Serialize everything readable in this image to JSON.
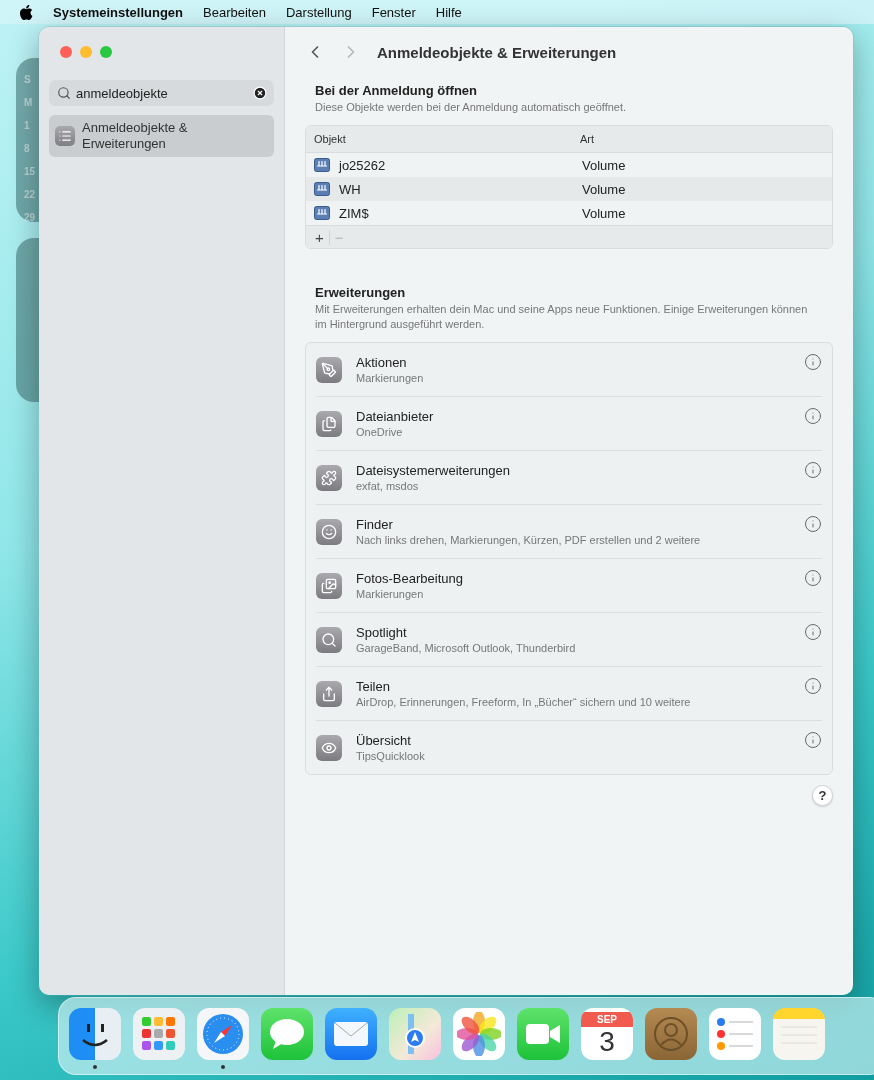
{
  "menu_bar": {
    "app": "Systemeinstellungen",
    "items": [
      "Bearbeiten",
      "Darstellung",
      "Fenster",
      "Hilfe"
    ]
  },
  "desktop_widget": {
    "lines": [
      "S",
      "M",
      "1",
      "8",
      "15",
      "22",
      "29"
    ]
  },
  "sidebar": {
    "search": {
      "value": "anmeldeobjekte"
    },
    "items": [
      {
        "label": "Anmeldeobjekte & Erweiterungen",
        "selected": true
      }
    ]
  },
  "toolbar": {
    "title": "Anmeldeobjekte & Erweiterungen"
  },
  "login_items": {
    "title": "Bei der Anmeldung öffnen",
    "description": "Diese Objekte werden bei der Anmeldung automatisch geöffnet.",
    "columns": [
      "Objekt",
      "Art"
    ],
    "rows": [
      {
        "name": "jo25262",
        "type": "Volume"
      },
      {
        "name": "WH",
        "type": "Volume"
      },
      {
        "name": "ZIM$",
        "type": "Volume"
      }
    ],
    "controls": [
      {
        "label": "+",
        "disabled": false
      },
      {
        "label": "−",
        "disabled": true
      }
    ]
  },
  "extensions": {
    "title": "Erweiterungen",
    "description": "Mit Erweiterungen erhalten dein Mac und seine Apps neue Funktionen. Einige Erweiterungen können im Hintergrund ausgeführt werden.",
    "items": [
      {
        "kind": "actions",
        "name": "Aktionen",
        "detail": "Markierungen"
      },
      {
        "kind": "files",
        "name": "Dateianbieter",
        "detail": "OneDrive"
      },
      {
        "kind": "filesystem",
        "name": "Dateisystemerweiterungen",
        "detail": "exfat, msdos"
      },
      {
        "kind": "finder",
        "name": "Finder",
        "detail": "Nach links drehen, Markierungen, Kürzen, PDF erstellen und 2 weitere"
      },
      {
        "kind": "photos",
        "name": "Fotos-Bearbeitung",
        "detail": "Markierungen"
      },
      {
        "kind": "spotlight",
        "name": "Spotlight",
        "detail": "GarageBand, Microsoft Outlook, Thunderbird"
      },
      {
        "kind": "share",
        "name": "Teilen",
        "detail": "AirDrop, Erinnerungen, Freeform, In „Bücher“ sichern und 10 weitere"
      },
      {
        "kind": "quicklook",
        "name": "Übersicht",
        "detail": "TipsQuicklook"
      }
    ]
  },
  "help": "?",
  "dock": {
    "apps": [
      {
        "kind": "finder",
        "running": true
      },
      {
        "kind": "launchpad",
        "running": false
      },
      {
        "kind": "safari",
        "running": true
      },
      {
        "kind": "messages",
        "running": false
      },
      {
        "kind": "mail",
        "running": false
      },
      {
        "kind": "maps",
        "running": false
      },
      {
        "kind": "photos",
        "running": false
      },
      {
        "kind": "facetime",
        "running": false
      },
      {
        "kind": "calendar",
        "running": false,
        "month": "SEP",
        "day": "3"
      },
      {
        "kind": "contacts",
        "running": false
      },
      {
        "kind": "reminders",
        "running": false
      },
      {
        "kind": "notes",
        "running": false
      }
    ]
  }
}
